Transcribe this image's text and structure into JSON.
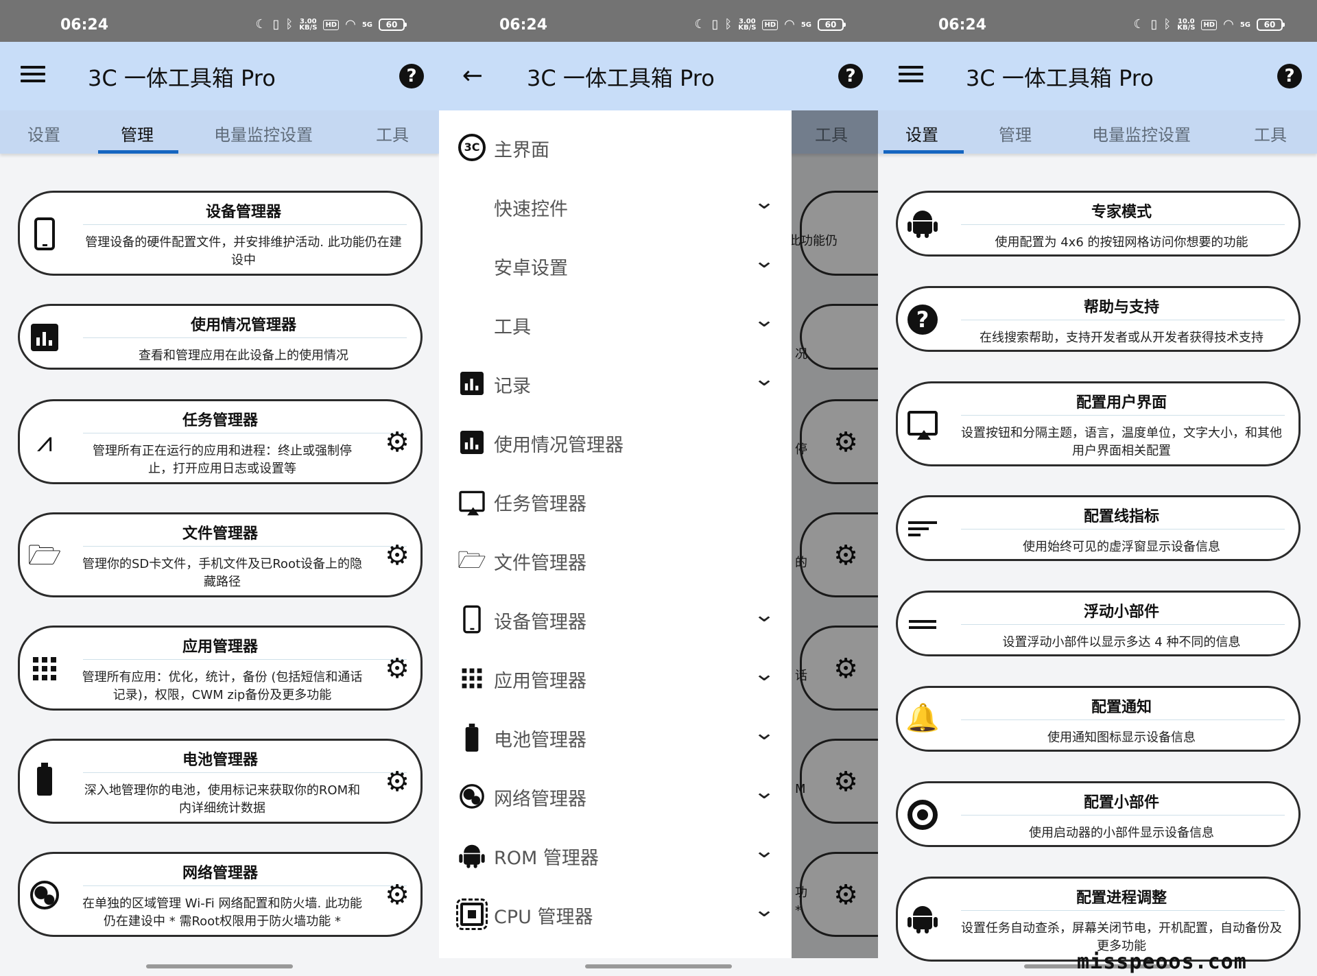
{
  "statusbar": {
    "time": "06:24",
    "speeds": [
      "3.00\nKB/S",
      "3.00\nKB/S",
      "10.0\nKB/S"
    ],
    "hd": "HD",
    "net": "5G",
    "battery": "60"
  },
  "app_title": "3C 一体工具箱 Pro",
  "help_icon": "?",
  "tabs": [
    "设置",
    "管理",
    "电量监控设置",
    "工具"
  ],
  "colors": {
    "appbar": "#c8ddf8",
    "tabbar": "#c5d8f2",
    "indicator": "#1565c0",
    "statusbar": "#737373"
  },
  "manage_cards": [
    {
      "title": "设备管理器",
      "desc": "管理设备的硬件配置文件，并安排维护活动. 此功能仍在建设中",
      "icon": "phone-icon",
      "gear": false
    },
    {
      "title": "使用情况管理器",
      "desc": "查看和管理应用在此设备上的使用情况",
      "icon": "bar-chart-icon",
      "gear": false
    },
    {
      "title": "任务管理器",
      "desc": "管理所有正在运行的应用和进程：终止或强制停止，打开应用日志或设置等",
      "icon": "pulse-icon",
      "gear": true
    },
    {
      "title": "文件管理器",
      "desc": "管理你的SD卡文件，手机文件及已Root设备上的隐藏路径",
      "icon": "folder-icon",
      "gear": true
    },
    {
      "title": "应用管理器",
      "desc": "管理所有应用：优化，统计，备份 (包括短信和通话记录)，权限，CWM zip备份及更多功能",
      "icon": "apps-grid-icon",
      "gear": true
    },
    {
      "title": "电池管理器",
      "desc": "深入地管理你的电池，使用标记来获取你的ROM和内详细统计数据",
      "icon": "battery-icon",
      "gear": true
    },
    {
      "title": "网络管理器",
      "desc": "在单独的区域管理 Wi-Fi 网络配置和防火墙. 此功能仍在建设中 * 需Root权限用于防火墙功能 *",
      "icon": "globe-icon",
      "gear": true
    }
  ],
  "drawer": {
    "items": [
      {
        "label": "主界面",
        "icon": "3c-logo-icon",
        "chevron": false
      },
      {
        "label": "快速控件",
        "icon": "",
        "chevron": true
      },
      {
        "label": "安卓设置",
        "icon": "",
        "chevron": true
      },
      {
        "label": "工具",
        "icon": "",
        "chevron": true
      },
      {
        "label": "记录",
        "icon": "bar-chart-icon",
        "chevron": true
      },
      {
        "label": "使用情况管理器",
        "icon": "bar-chart-icon",
        "chevron": false
      },
      {
        "label": "任务管理器",
        "icon": "cast-screen-icon",
        "chevron": false
      },
      {
        "label": "文件管理器",
        "icon": "folder-icon",
        "chevron": false
      },
      {
        "label": "设备管理器",
        "icon": "phone-icon",
        "chevron": true
      },
      {
        "label": "应用管理器",
        "icon": "apps-grid-icon",
        "chevron": true
      },
      {
        "label": "电池管理器",
        "icon": "battery-icon",
        "chevron": true
      },
      {
        "label": "网络管理器",
        "icon": "globe-icon",
        "chevron": true
      },
      {
        "label": "ROM 管理器",
        "icon": "android-icon",
        "chevron": true
      },
      {
        "label": "CPU 管理器",
        "icon": "cpu-chip-icon",
        "chevron": true
      }
    ],
    "scrim_fragments": [
      "此功能仍",
      "况",
      "停",
      "的",
      "话",
      "M",
      "功\n*"
    ]
  },
  "settings_cards": [
    {
      "title": "专家模式",
      "desc": "使用配置为 4x6 的按钮网格访问你想要的功能",
      "icon": "android-icon"
    },
    {
      "title": "帮助与支持",
      "desc": "在线搜索帮助，支持开发者或从开发者获得技术支持",
      "icon": "help-circle-icon"
    },
    {
      "title": "配置用户界面",
      "desc": "设置按钮和分隔主题，语言，温度单位，文字大小，和其他用户界面相关配置",
      "icon": "cast-screen-icon"
    },
    {
      "title": "配置线指标",
      "desc": "使用始终可见的虚浮窗显示设备信息",
      "icon": "lines-icon"
    },
    {
      "title": "浮动小部件",
      "desc": "设置浮动小部件以显示多达 4 种不同的信息",
      "icon": "equals-icon"
    },
    {
      "title": "配置通知",
      "desc": "使用通知图标显示设备信息",
      "icon": "bell-icon"
    },
    {
      "title": "配置小部件",
      "desc": "使用启动器的小部件显示设备信息",
      "icon": "widget-ring-icon"
    },
    {
      "title": "配置进程调整",
      "desc": "设置任务自动查杀，屏幕关闭节电，开机配置，自动备份及更多功能",
      "icon": "android-icon"
    }
  ],
  "watermark": "misspeoos.com"
}
